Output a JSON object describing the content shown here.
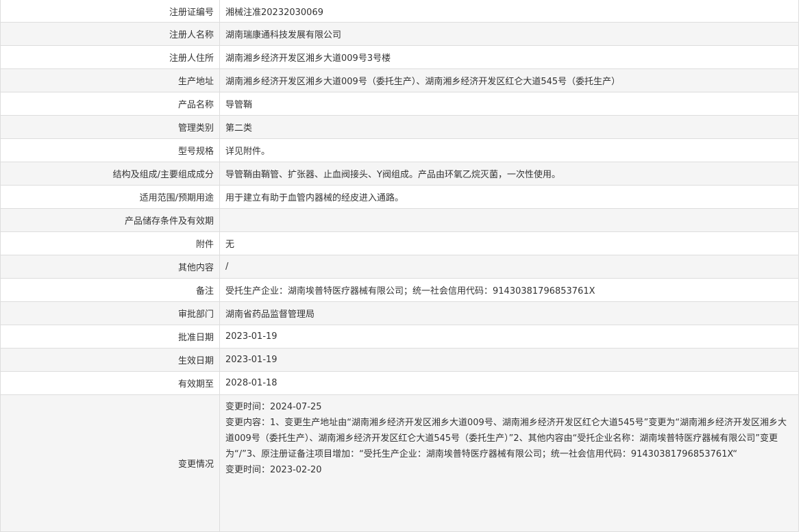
{
  "rows": [
    {
      "label": "注册证编号",
      "value": "湘械注准20232030069"
    },
    {
      "label": "注册人名称",
      "value": "湖南瑞康通科技发展有限公司"
    },
    {
      "label": "注册人住所",
      "value": "湖南湘乡经济开发区湘乡大道009号3号楼"
    },
    {
      "label": "生产地址",
      "value": "湖南湘乡经济开发区湘乡大道009号（委托生产）、湖南湘乡经济开发区红仑大道545号（委托生产）"
    },
    {
      "label": "产品名称",
      "value": "导管鞘"
    },
    {
      "label": "管理类别",
      "value": "第二类"
    },
    {
      "label": "型号规格",
      "value": "详见附件。"
    },
    {
      "label": "结构及组成/主要组成成分",
      "value": "导管鞘由鞘管、扩张器、止血阀接头、Y阀组成。产品由环氧乙烷灭菌，一次性使用。"
    },
    {
      "label": "适用范围/预期用途",
      "value": "用于建立有助于血管内器械的经皮进入通路。"
    },
    {
      "label": "产品储存条件及有效期",
      "value": ""
    },
    {
      "label": "附件",
      "value": "无"
    },
    {
      "label": "其他内容",
      "value": "/"
    },
    {
      "label": "备注",
      "value": "受托生产企业：湖南埃普特医疗器械有限公司；统一社会信用代码：91430381796853761X"
    },
    {
      "label": "审批部门",
      "value": "湖南省药品监督管理局"
    },
    {
      "label": "批准日期",
      "value": "2023-01-19"
    },
    {
      "label": "生效日期",
      "value": "2023-01-19"
    },
    {
      "label": "有效期至",
      "value": "2028-01-18"
    }
  ],
  "changes": {
    "label": "变更情况",
    "entries": [
      {
        "time": "变更时间：2024-07-25",
        "content": "变更内容：1、变更生产地址由“湖南湘乡经济开发区湘乡大道009号、湖南湘乡经济开发区红仑大道545号”变更为“湖南湘乡经济开发区湘乡大道009号（委托生产）、湖南湘乡经济开发区红仑大道545号（委托生产）”2、其他内容由“受托企业名称：湖南埃普特医疗器械有限公司”变更为“/”3、原注册证备注项目增加：“受托生产企业：湖南埃普特医疗器械有限公司；统一社会信用代码：91430381796853761X“"
      },
      {
        "time": "变更时间：2023-02-20"
      }
    ]
  }
}
